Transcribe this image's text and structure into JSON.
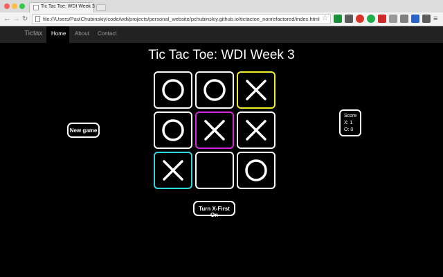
{
  "browser": {
    "tab_title": "Tic Tac Toe: WDI Week 3",
    "tab_close": "×",
    "url": "file:///Users/PaulChubinskiy/code/wdi/projects/personal_website/pchubinskiy.github.io/tictactoe_nonrefactored/index.html",
    "icons": [
      "back-arrow-icon",
      "forward-arrow-icon",
      "reload-icon",
      "bookmark-star-icon",
      "menu-icon"
    ]
  },
  "navbar": {
    "brand": "Tictax",
    "items": [
      {
        "label": "Home",
        "active": true
      },
      {
        "label": "About",
        "active": false
      },
      {
        "label": "Contact",
        "active": false
      }
    ]
  },
  "page": {
    "heading": "Tic Tac Toe: WDI Week 3",
    "new_game_label": "New game",
    "first_toggle_label": "Turn X-First On"
  },
  "score": {
    "title": "Score",
    "x": "X: 1",
    "o": "O: 0"
  },
  "board": {
    "cells": [
      "O",
      "O",
      "X",
      "O",
      "X",
      "X",
      "X",
      "",
      "O"
    ],
    "highlights": [
      "",
      "",
      "yellow",
      "",
      "magenta",
      "",
      "cyan",
      "",
      ""
    ]
  },
  "colors": {
    "highlight_yellow": "#f2ee2a",
    "highlight_magenta": "#d028d8",
    "highlight_cyan": "#2fd8de",
    "navbar": "#222222",
    "background": "#000000"
  }
}
